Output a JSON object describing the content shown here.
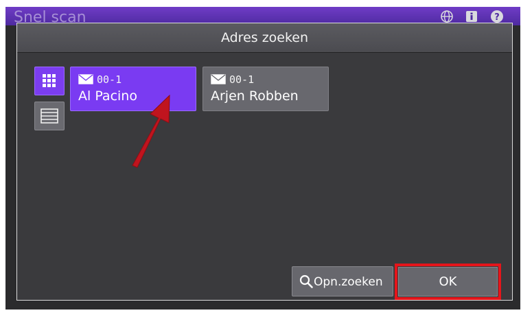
{
  "app": {
    "title": "Snel scan"
  },
  "topbar": {
    "icons": [
      "globe-icon",
      "info-icon",
      "help-icon"
    ]
  },
  "dialog": {
    "title": "Adres zoeken",
    "view_modes": [
      "grid-view-icon",
      "list-view-icon"
    ],
    "selected_view": "grid",
    "entries": [
      {
        "code": "00-1",
        "name": "Al Pacino",
        "selected": true
      },
      {
        "code": "00-1",
        "name": "Arjen Robben",
        "selected": false
      }
    ],
    "buttons": {
      "search": "Opn.zoeken",
      "ok": "OK"
    }
  },
  "colors": {
    "accent": "#7a3bf2",
    "highlight_border": "#e5151b",
    "annotation_arrow": "#c0141e",
    "background": "#3a3a3d"
  }
}
